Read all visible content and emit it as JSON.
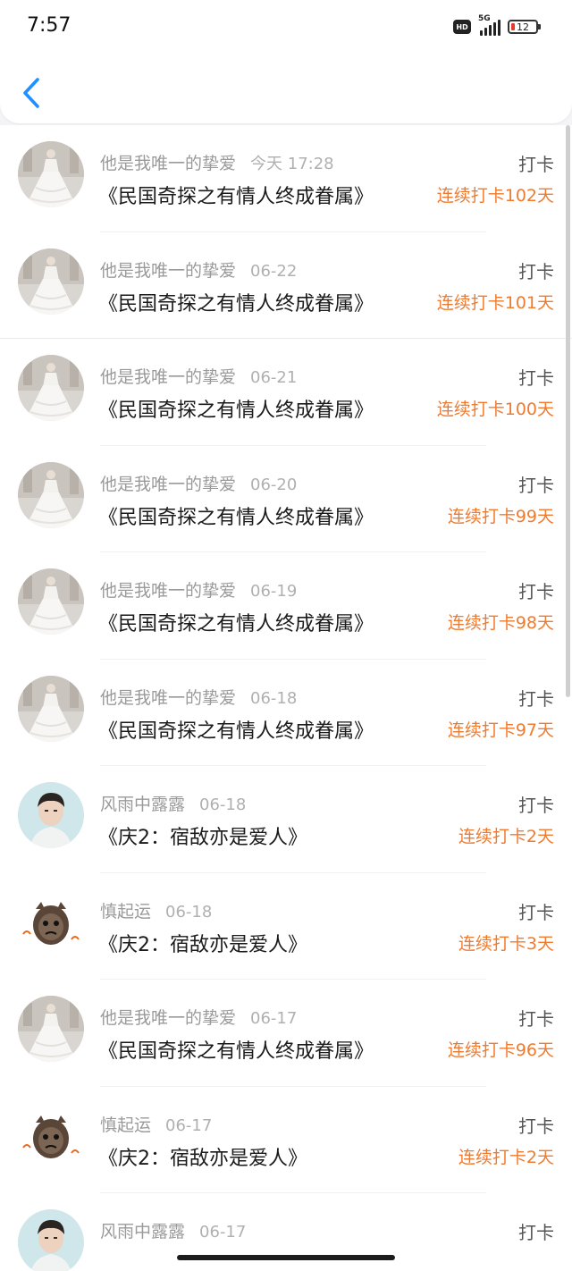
{
  "status_bar": {
    "time": "7:57",
    "hd": "HD",
    "network": "5G",
    "battery": "12"
  },
  "colors": {
    "accent": "#1e90ff",
    "streak": "#f07b2f"
  },
  "punch_label": "打卡",
  "items": [
    {
      "user": "他是我唯一的挚爱",
      "date": "今天 17:28",
      "title": "《民国奇探之有情人终成眷属》",
      "streak": "连续打卡102天",
      "avatar": "wedding-dress"
    },
    {
      "user": "他是我唯一的挚爱",
      "date": "06-22",
      "title": "《民国奇探之有情人终成眷属》",
      "streak": "连续打卡101天",
      "avatar": "wedding-dress"
    },
    {
      "user": "他是我唯一的挚爱",
      "date": "06-21",
      "title": "《民国奇探之有情人终成眷属》",
      "streak": "连续打卡100天",
      "avatar": "wedding-dress"
    },
    {
      "user": "他是我唯一的挚爱",
      "date": "06-20",
      "title": "《民国奇探之有情人终成眷属》",
      "streak": "连续打卡99天",
      "avatar": "wedding-dress"
    },
    {
      "user": "他是我唯一的挚爱",
      "date": "06-19",
      "title": "《民国奇探之有情人终成眷属》",
      "streak": "连续打卡98天",
      "avatar": "wedding-dress"
    },
    {
      "user": "他是我唯一的挚爱",
      "date": "06-18",
      "title": "《民国奇探之有情人终成眷属》",
      "streak": "连续打卡97天",
      "avatar": "wedding-dress"
    },
    {
      "user": "风雨中露露",
      "date": "06-18",
      "title": "《庆2：宿敌亦是爱人》",
      "streak": "连续打卡2天",
      "avatar": "man-portrait"
    },
    {
      "user": "慎起运",
      "date": "06-18",
      "title": "《庆2：宿敌亦是爱人》",
      "streak": "连续打卡3天",
      "avatar": "sticker-baby"
    },
    {
      "user": "他是我唯一的挚爱",
      "date": "06-17",
      "title": "《民国奇探之有情人终成眷属》",
      "streak": "连续打卡96天",
      "avatar": "wedding-dress"
    },
    {
      "user": "慎起运",
      "date": "06-17",
      "title": "《庆2：宿敌亦是爱人》",
      "streak": "连续打卡2天",
      "avatar": "sticker-baby"
    },
    {
      "user": "风雨中露露",
      "date": "06-17",
      "title": "",
      "streak": "",
      "avatar": "man-portrait"
    }
  ]
}
